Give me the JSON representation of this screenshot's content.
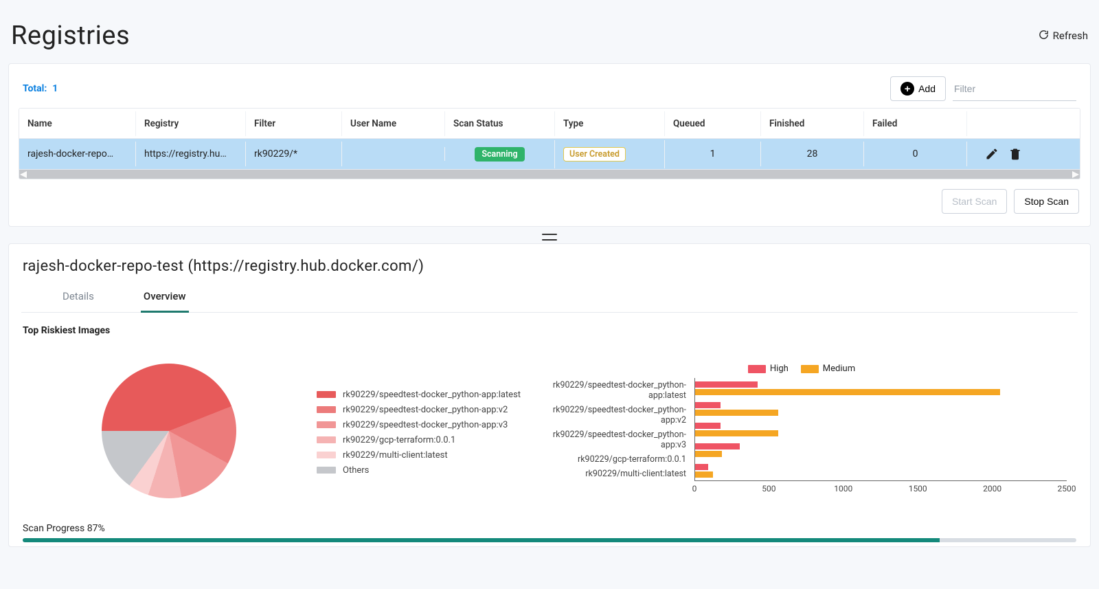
{
  "page": {
    "title": "Registries",
    "refresh_label": "Refresh"
  },
  "summary": {
    "total_label": "Total:",
    "total_count": "1"
  },
  "toolbar": {
    "add_label": "Add",
    "filter_placeholder": "Filter",
    "start_scan_label": "Start Scan",
    "stop_scan_label": "Stop Scan"
  },
  "columns": [
    "Name",
    "Registry",
    "Filter",
    "User Name",
    "Scan Status",
    "Type",
    "Queued",
    "Finished",
    "Failed",
    ""
  ],
  "row": {
    "name": "rajesh-docker-repo…",
    "registry": "https://registry.hu…",
    "filter": "rk90229/*",
    "username": "",
    "scan_status": "Scanning",
    "type": "User Created",
    "queued": "1",
    "finished": "28",
    "failed": "0"
  },
  "detail": {
    "title": "rajesh-docker-repo-test (https://registry.hub.docker.com/)",
    "tabs": {
      "details": "Details",
      "overview": "Overview"
    },
    "subtitle": "Top Riskiest Images",
    "scan_progress_label": "Scan Progress 87%",
    "scan_progress_pct": 87
  },
  "pie_legend": [
    "rk90229/speedtest-docker_python-app:latest",
    "rk90229/speedtest-docker_python-app:v2",
    "rk90229/speedtest-docker_python-app:v3",
    "rk90229/gcp-terraform:0.0.1",
    "rk90229/multi-client:latest",
    "Others"
  ],
  "pie_colors": [
    "#e75a5a",
    "#ec7b7b",
    "#f19696",
    "#f5b3b3",
    "#fad1d1",
    "#c5c7cb"
  ],
  "bar_legend": {
    "high": "High",
    "medium": "Medium"
  },
  "bar_colors": {
    "high": "#ef5464",
    "medium": "#f5a623"
  },
  "chart_data": [
    {
      "type": "pie",
      "title": "Top Riskiest Images",
      "categories": [
        "rk90229/speedtest-docker_python-app:latest",
        "rk90229/speedtest-docker_python-app:v2",
        "rk90229/speedtest-docker_python-app:v3",
        "rk90229/gcp-terraform:0.0.1",
        "rk90229/multi-client:latest",
        "Others"
      ],
      "values": [
        44,
        14,
        14,
        8,
        5,
        15
      ]
    },
    {
      "type": "bar",
      "orientation": "horizontal",
      "categories": [
        "rk90229/speedtest-docker_python-app:latest",
        "rk90229/speedtest-docker_python-app:v2",
        "rk90229/speedtest-docker_python-app:v3",
        "rk90229/gcp-terraform:0.0.1",
        "rk90229/multi-client:latest"
      ],
      "series": [
        {
          "name": "High",
          "values": [
            420,
            170,
            170,
            300,
            90
          ]
        },
        {
          "name": "Medium",
          "values": [
            2050,
            560,
            560,
            180,
            120
          ]
        }
      ],
      "xlabel": "",
      "ylabel": "",
      "xlim": [
        0,
        2500
      ],
      "xticks": [
        0,
        500,
        1000,
        1500,
        2000,
        2500
      ]
    }
  ]
}
